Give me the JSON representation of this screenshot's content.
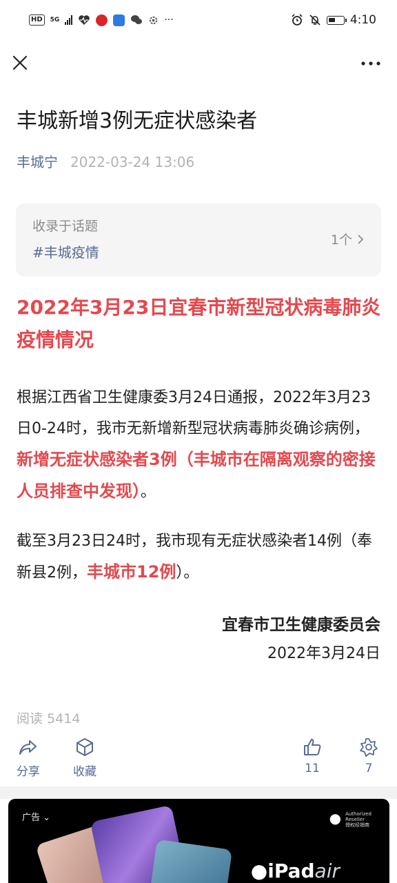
{
  "status_bar": {
    "network_badge": "HD",
    "signal_label": "5G",
    "overflow": "···",
    "time": "4:10"
  },
  "article": {
    "title": "丰城新增3例无症状感染者",
    "author": "丰城宁",
    "date": "2022-03-24 13:06",
    "topic": {
      "label": "收录于话题",
      "tag": "#丰城疫情",
      "count": "1个"
    },
    "headline": "2022年3月23日宜春市新型冠状病毒肺炎疫情情况",
    "para1": {
      "text": "根据江西省卫生健康委3月24日通报，2022年3月23日0-24时，我市无新增新型冠状病毒肺炎确诊病例，",
      "highlight": "新增无症状感染者3例（丰城市在隔离观察的密接人员排查中发现）",
      "end": "。"
    },
    "para2": {
      "text": "截至3月23日24时，我市现有无症状感染者14例（奉新县2例，",
      "highlight": "丰城市12例",
      "end": "）。"
    },
    "signature_org": "宜春市卫生健康委员会",
    "signature_date": "2022年3月24日",
    "reads_label": "阅读",
    "reads_count": "5414"
  },
  "actions": {
    "share": "分享",
    "favorite": "收藏",
    "likes": "11",
    "wow": "7"
  },
  "ad": {
    "label": "广告",
    "reseller_line1": "Authorized",
    "reseller_line2": "Reseller",
    "reseller_line3": "授权经销商",
    "brand_main": "iPad",
    "brand_sub": "air"
  },
  "colors": {
    "accent_link": "#576b95",
    "highlight_red": "#e5484d",
    "muted": "#b3b3b3"
  }
}
